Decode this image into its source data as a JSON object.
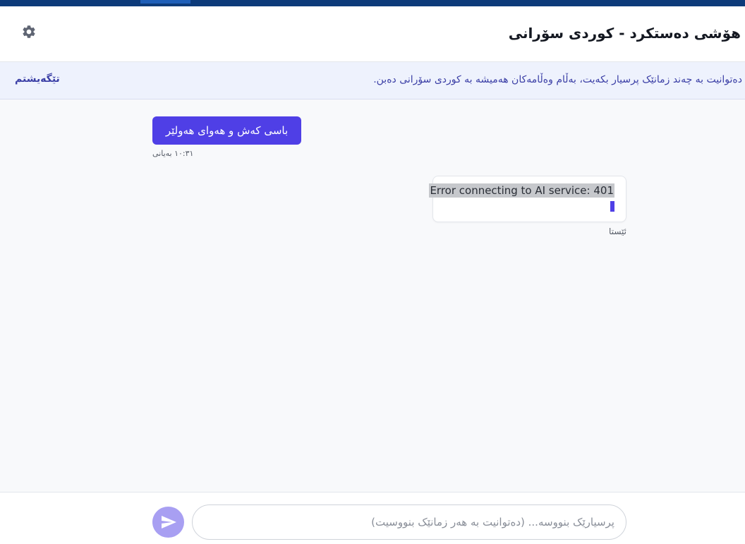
{
  "header": {
    "title": "هۆشی دەستکرد - کوردی سۆرانی",
    "settings_icon": "gear-icon"
  },
  "notice": {
    "text": "دەتوانیت بە چەند زمانێک پرسیار بکەیت، بەڵام وەڵامەکان هەمیشە بە کوردی سۆرانی دەبن.",
    "dismiss_label": "تێگەیشتم"
  },
  "messages": [
    {
      "role": "user",
      "text": "باسی کەش و هەوای هەولێر",
      "time": "١٠:٣١ بەیانی"
    },
    {
      "role": "assistant",
      "text": "Error connecting to AI service: 401",
      "time": "ئێستا"
    }
  ],
  "composer": {
    "placeholder": "پرسیارێک بنووسە... (دەتوانیت بە هەر زمانێک بنووسیت)",
    "value": "",
    "send_icon": "send-icon"
  },
  "colors": {
    "accent": "#4f3fe6",
    "send_button": "#a89ff2",
    "top_bar": "#0d3b7a",
    "notice_bg": "#eef2fd",
    "notice_text": "#3b3fa6"
  }
}
